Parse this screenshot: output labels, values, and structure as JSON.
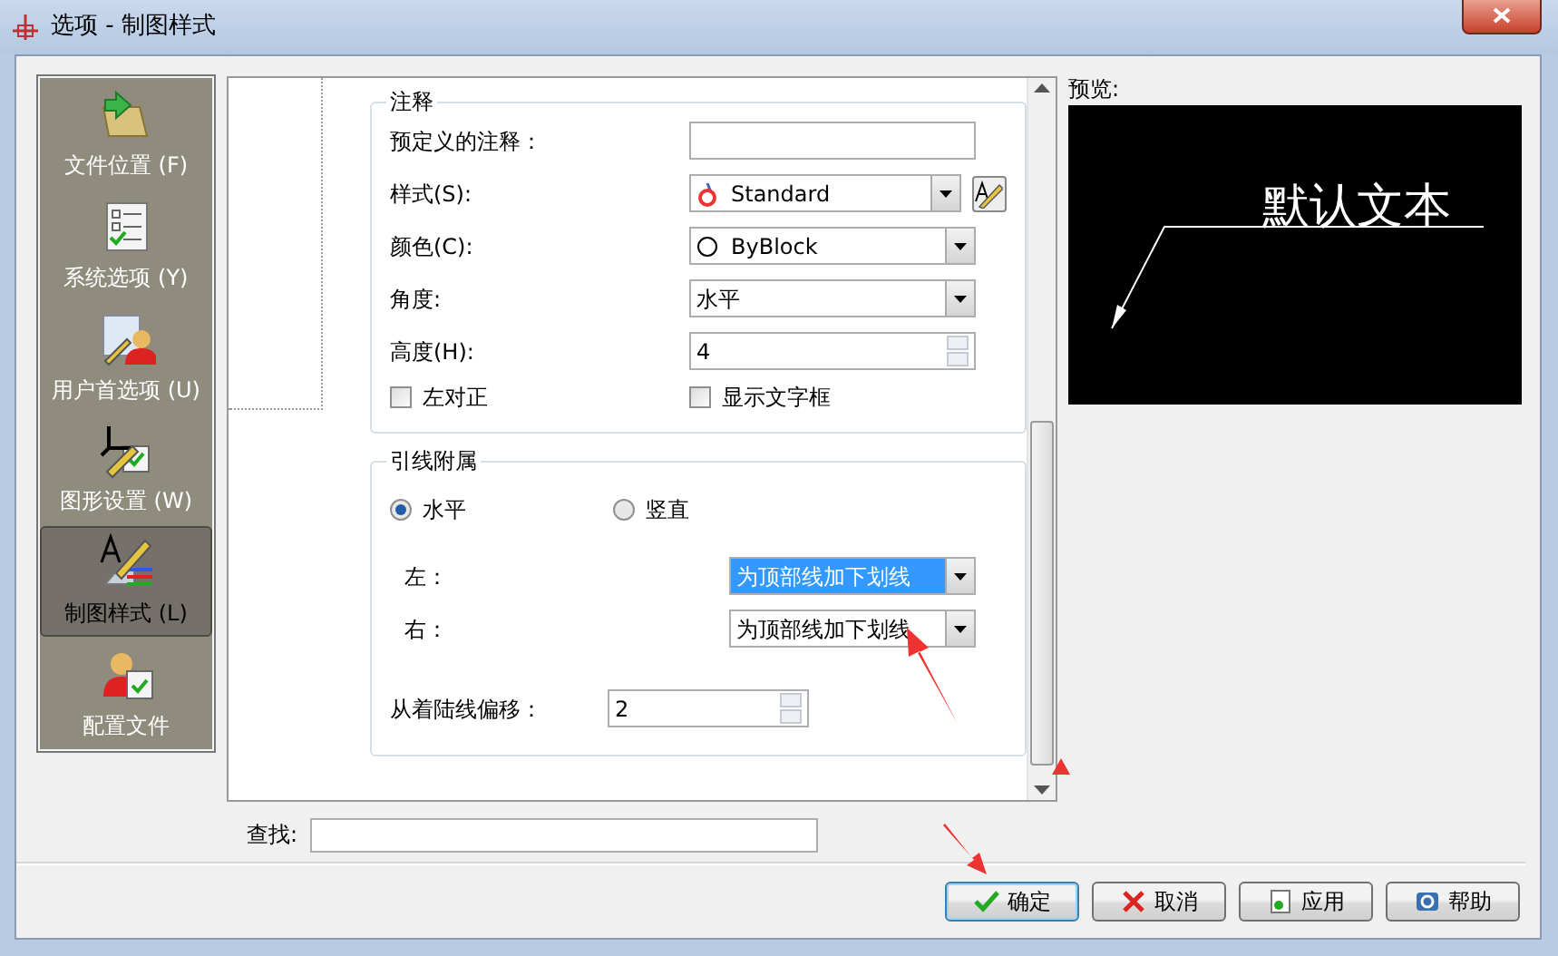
{
  "window": {
    "title": "选项 - 制图样式"
  },
  "sidebar": {
    "items": [
      {
        "label": "文件位置 (F)",
        "selected": false
      },
      {
        "label": "系统选项 (Y)",
        "selected": false
      },
      {
        "label": "用户首选项 (U)",
        "selected": false
      },
      {
        "label": "图形设置 (W)",
        "selected": false
      },
      {
        "label": "制图样式 (L)",
        "selected": true
      },
      {
        "label": "配置文件",
        "selected": false
      }
    ]
  },
  "annotation_group": {
    "title": "注释",
    "fields": [
      {
        "kind": "text",
        "label": "预定义的注释："
      },
      {
        "kind": "style-combo",
        "label": "样式(S):",
        "value": "Standard"
      },
      {
        "kind": "color-combo",
        "label": "颜色(C):",
        "value": "ByBlock"
      },
      {
        "kind": "combo",
        "label": "角度:",
        "value": "水平"
      },
      {
        "kind": "spin",
        "label": "高度(H):",
        "value": "4"
      }
    ],
    "checkboxes": [
      {
        "label": "左对正",
        "checked": false
      },
      {
        "label": "显示文字框",
        "checked": false
      }
    ]
  },
  "leader_group": {
    "title": "引线附属",
    "radios": [
      {
        "label": "水平",
        "selected": true
      },
      {
        "label": "竖直",
        "selected": false
      }
    ],
    "sides": [
      {
        "label": "左：",
        "value": "为顶部线加下划线",
        "selected": true
      },
      {
        "label": "右：",
        "value": "为顶部线加下划线",
        "selected": false
      }
    ],
    "offset": {
      "label": "从着陆线偏移：",
      "value": "2"
    }
  },
  "preview": {
    "label": "预览:",
    "text": "默认文本"
  },
  "find": {
    "label": "查找:"
  },
  "buttons": [
    {
      "kind": "ok",
      "label": "确定",
      "default": true
    },
    {
      "kind": "cancel",
      "label": "取消",
      "default": false
    },
    {
      "kind": "apply",
      "label": "应用",
      "default": false
    },
    {
      "kind": "help",
      "label": "帮助",
      "default": false
    }
  ]
}
